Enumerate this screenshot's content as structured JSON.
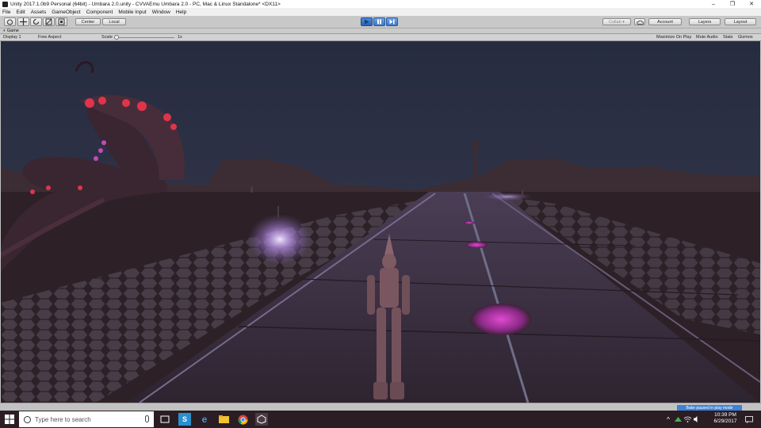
{
  "window": {
    "title": "Unity 2017.1.0b9 Personal (64bit) - Umbara 2.0.unity - CVVAEmu Umbara 2.0 - PC, Mac & Linux Standalone* <DX11>",
    "minimize": "–",
    "maximize": "❐",
    "close": "✕"
  },
  "menu": [
    "File",
    "Edit",
    "Assets",
    "GameObject",
    "Component",
    "Mobile Input",
    "Window",
    "Help"
  ],
  "toolbar": {
    "pivot_label": "Center",
    "space_label": "Local",
    "collab_label": "Collab ▾",
    "account_label": "Account",
    "layers_label": "Layers",
    "layout_label": "Layout"
  },
  "game_view": {
    "tab_label": "Game",
    "display": "Display 1",
    "aspect": "Free Aspect",
    "scale_label": "Scale",
    "scale_value": "1x",
    "maximize_on_play": "Maximize On Play",
    "mute_audio": "Mute Audio",
    "stats": "Stats",
    "gizmos": "Gizmos"
  },
  "status": {
    "bake_message": "Bake paused in play mode"
  },
  "taskbar": {
    "search_placeholder": "Type here to search",
    "time": "10:39 PM",
    "date": "6/29/2017"
  },
  "colors": {
    "sky": "#2d3346",
    "ground": "#2a1f24",
    "road": "#3b2f3e",
    "glow": "#c79cf2",
    "character": "#7e5a62",
    "accent_blue": "#3e82d6"
  }
}
